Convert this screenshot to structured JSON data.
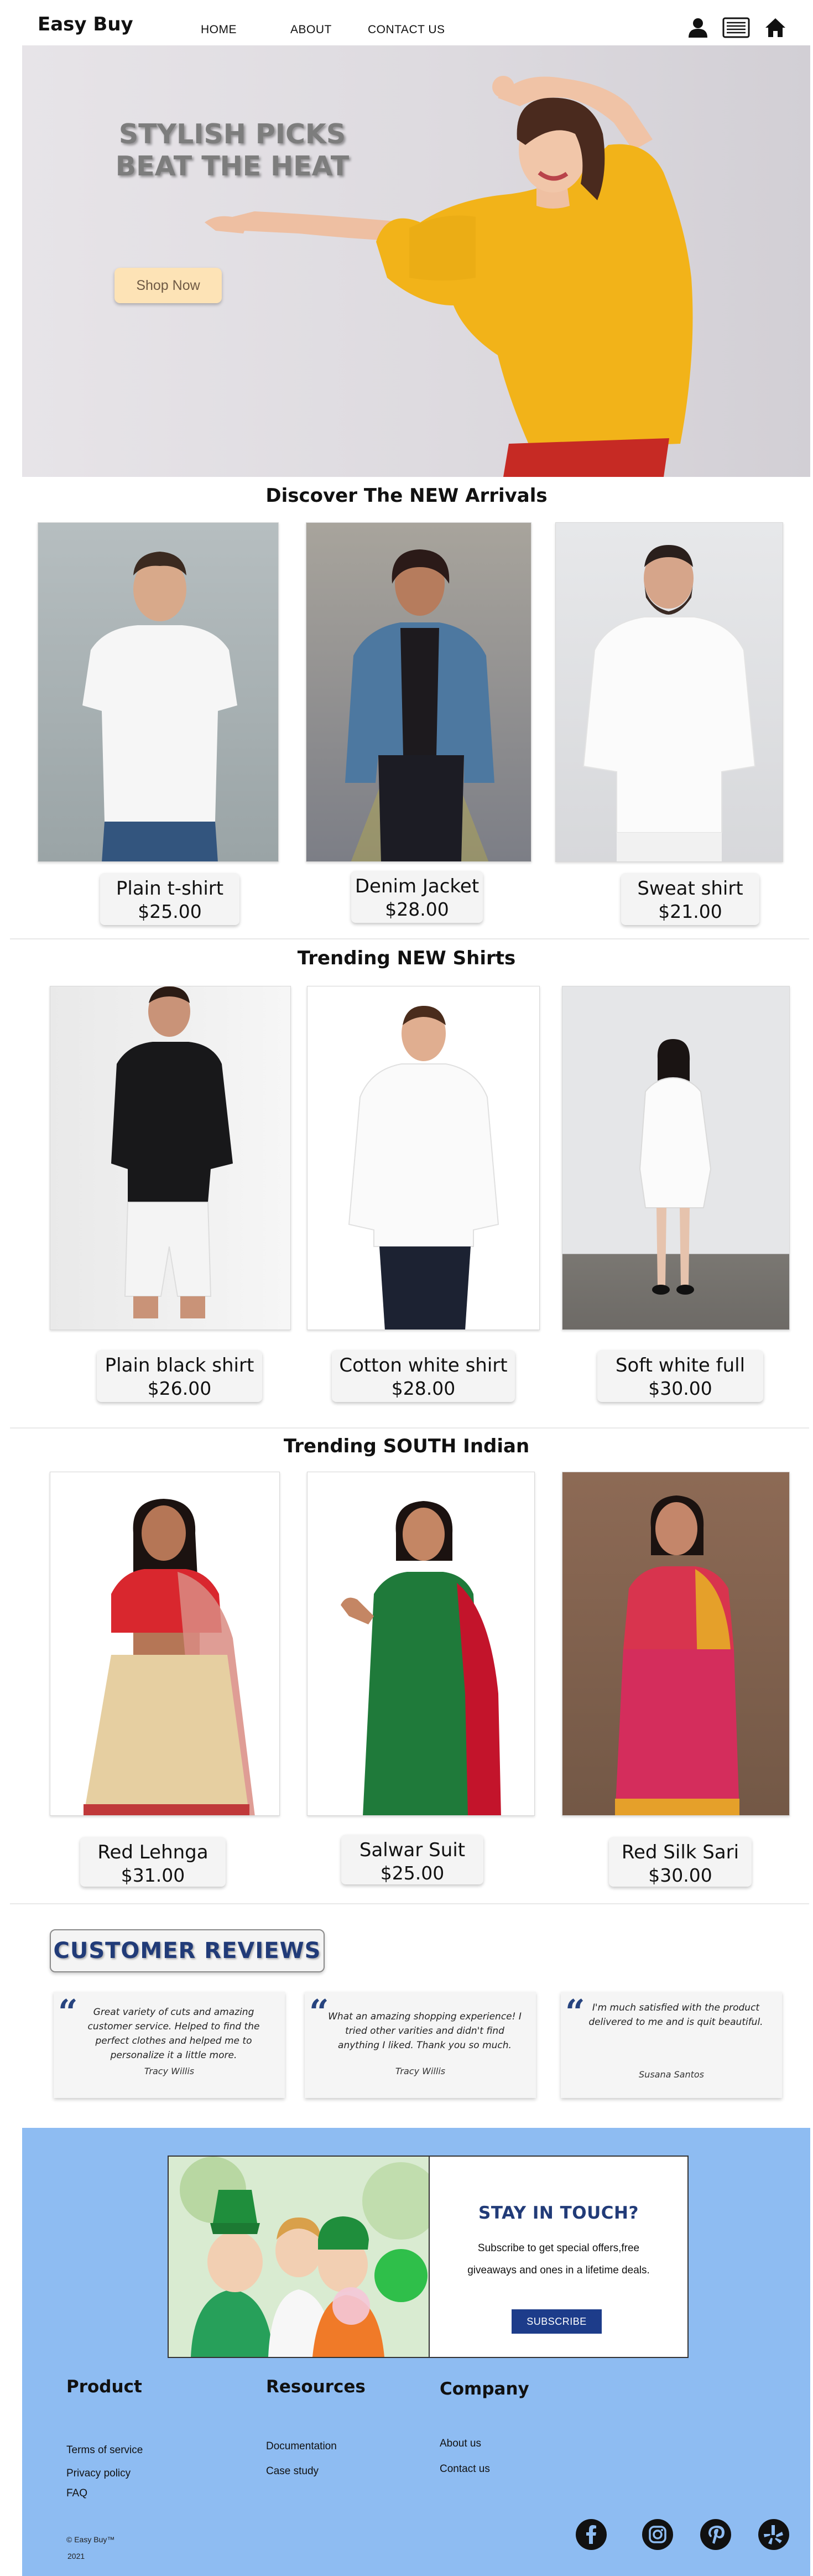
{
  "nav": {
    "brand": "Easy Buy",
    "links": [
      "HOME",
      "ABOUT",
      "CONTACT US"
    ],
    "icons": [
      "user-icon",
      "menu-icon",
      "home-icon"
    ]
  },
  "hero": {
    "title": "STYLISH PICKS BEAT THE HEAT",
    "cta": "Shop Now",
    "colors": {
      "shirt": "#f2b319",
      "background": "#e4e1e6",
      "button": "#fde3b6"
    }
  },
  "sections": [
    {
      "title": "Discover The NEW Arrivals",
      "products": [
        {
          "name": "Plain t-shirt",
          "price": "$25.00"
        },
        {
          "name": "Denim Jacket",
          "price": "$28.00"
        },
        {
          "name": "Sweat shirt",
          "price": "$21.00"
        }
      ]
    },
    {
      "title": "Trending NEW Shirts",
      "products": [
        {
          "name": "Plain black shirt",
          "price": "$26.00"
        },
        {
          "name": "Cotton white shirt",
          "price": "$28.00"
        },
        {
          "name": "Soft white full",
          "price": "$30.00"
        }
      ]
    },
    {
      "title": "Trending SOUTH Indian",
      "products": [
        {
          "name": "Red Lehnga",
          "price": "$31.00"
        },
        {
          "name": "Salwar Suit",
          "price": "$25.00"
        },
        {
          "name": "Red Silk Sari",
          "price": "$30.00"
        }
      ]
    }
  ],
  "reviews": {
    "title": "CUSTOMER REVIEWS",
    "items": [
      {
        "text": "Great variety of cuts and amazing customer service. Helped to find the perfect clothes and helped me to personalize it a little more.",
        "author": "Tracy Willis"
      },
      {
        "text": "What an amazing shopping experience! I tried other varities and didn't find anything I liked. Thank you so much.",
        "author": "Tracy Willis"
      },
      {
        "text": "I'm much satisfied with the product delivered to me and is quit beautiful.",
        "author": "Susana Santos"
      }
    ]
  },
  "newsletter": {
    "title": "STAY IN TOUCH?",
    "text": "Subscribe to get special offers,free giveaways and ones in a lifetime deals.",
    "button": "SUBSCRIBE"
  },
  "footer": {
    "columns": [
      {
        "heading": "Product",
        "links": [
          "Terms of service",
          "Privacy policy",
          "FAQ"
        ]
      },
      {
        "heading": "Resources",
        "links": [
          "Documentation",
          "Case study"
        ]
      },
      {
        "heading": "Company",
        "links": [
          "About us",
          "Contact us"
        ]
      }
    ],
    "copyright": "© Easy Buy™",
    "year": "2021",
    "social": [
      "facebook-icon",
      "instagram-icon",
      "pinterest-icon",
      "yelp-icon"
    ],
    "background": "#8ebcf2"
  }
}
